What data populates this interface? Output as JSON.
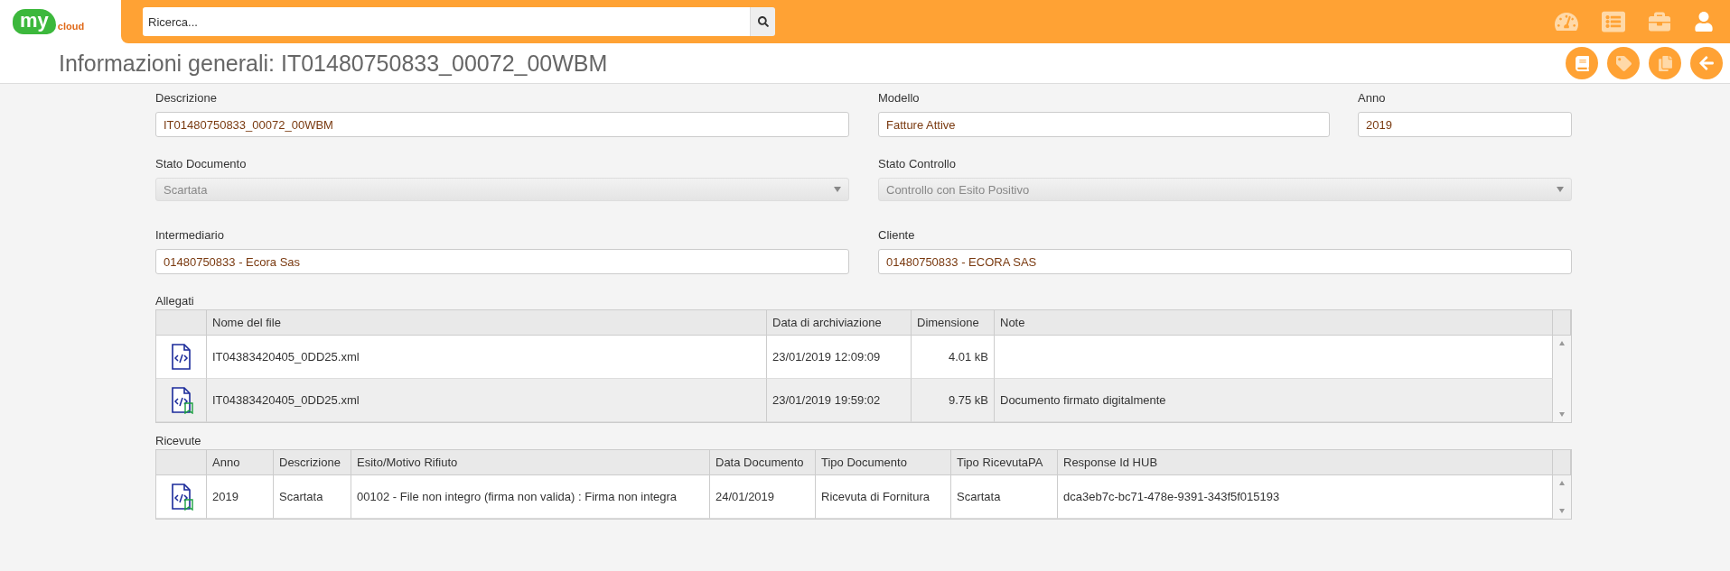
{
  "logo": {
    "main": "my",
    "sub": "cloud"
  },
  "search": {
    "placeholder": "Ricerca..."
  },
  "page_title": "Informazioni generali: IT01480750833_00072_00WBM",
  "form_rows": [
    [
      {
        "label": "Descrizione",
        "value": "IT01480750833_00072_00WBM",
        "kind": "text",
        "disabled": false
      },
      {
        "label": "Modello",
        "value": "Fatture Attive",
        "kind": "text",
        "disabled": false
      },
      {
        "label": "Anno",
        "value": "2019",
        "kind": "text",
        "disabled": false
      }
    ],
    [
      {
        "label": "Stato Documento",
        "value": "Scartata",
        "kind": "select",
        "disabled": true
      },
      {
        "label": "Stato Controllo",
        "value": "Controllo con Esito Positivo",
        "kind": "select",
        "disabled": true
      }
    ],
    [
      {
        "label": "Intermediario",
        "value": "01480750833 - Ecora Sas",
        "kind": "text",
        "disabled": false
      },
      {
        "label": "Cliente",
        "value": "01480750833 - ECORA SAS",
        "kind": "text",
        "disabled": false
      }
    ]
  ],
  "tables": [
    {
      "title": "Allegati",
      "columns": [
        "Nome del file",
        "Data di archiviazione",
        "Dimensione",
        "Note"
      ],
      "rows": [
        {
          "kind": "xml",
          "cells": [
            "IT04383420405_0DD25.xml",
            "23/01/2019 12:09:09",
            "4.01 kB"
          ]
        },
        {
          "kind": "signed",
          "cells": [
            "IT04383420405_0DD25.xml",
            "23/01/2019 19:59:02",
            "9.75 kB",
            "Documento firmato digitalmente"
          ]
        }
      ]
    },
    {
      "title": "Ricevute",
      "columns": [
        "Anno",
        "Descrizione",
        "Esito/Motivo Rifiuto",
        "Data Documento",
        "Tipo Documento",
        "Tipo RicevutaPA",
        "Response Id HUB"
      ],
      "rows": [
        {
          "kind": "signed",
          "cells": [
            "2019",
            "Scartata",
            "00102 - File non integro (firma non valida) : Firma non integra",
            "24/01/2019",
            "Ricevuta di Fornitura",
            "Scartata",
            "dca3eb7c-bc71-478e-9391-343f5f015193"
          ]
        }
      ]
    }
  ]
}
